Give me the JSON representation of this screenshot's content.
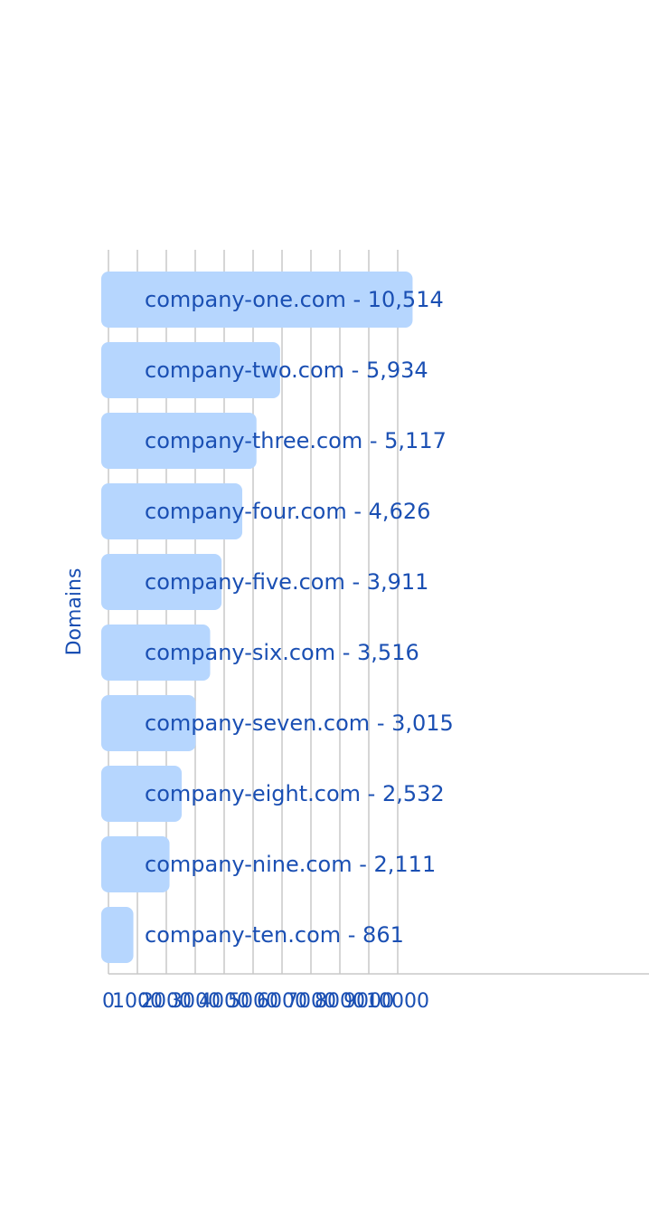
{
  "colors": {
    "bar": "#b6d6fe",
    "label": "#1a4fb3",
    "grid": "#c8c8c8",
    "axis": "#c8c8c8"
  },
  "chart_data": {
    "type": "bar",
    "orientation": "horizontal",
    "ylabel": "Domains",
    "xlabel": "",
    "xlim": [
      0,
      18600
    ],
    "grid": true,
    "x_ticks": [
      0,
      1000,
      2000,
      3000,
      4000,
      5000,
      6000,
      7000,
      8000,
      9000,
      10000
    ],
    "x_tick_labels": [
      "0",
      "1000",
      "2000",
      "3000",
      "4000",
      "5000",
      "6000",
      "7000",
      "8000",
      "9000",
      "10000"
    ],
    "categories": [
      "company-one.com",
      "company-two.com",
      "company-three.com",
      "company-four.com",
      "company-five.com",
      "company-six.com",
      "company-seven.com",
      "company-eight.com",
      "company-nine.com",
      "company-ten.com"
    ],
    "values": [
      10514,
      5934,
      5117,
      4626,
      3911,
      3516,
      3015,
      2532,
      2111,
      861
    ],
    "data_labels": [
      "company-one.com - 10,514",
      "company-two.com - 5,934",
      "company-three.com - 5,117",
      "company-four.com - 4,626",
      "company-five.com - 3,911",
      "company-six.com - 3,516",
      "company-seven.com - 3,015",
      "company-eight.com - 2,532",
      "company-nine.com - 2,111",
      "company-ten.com - 861"
    ]
  }
}
